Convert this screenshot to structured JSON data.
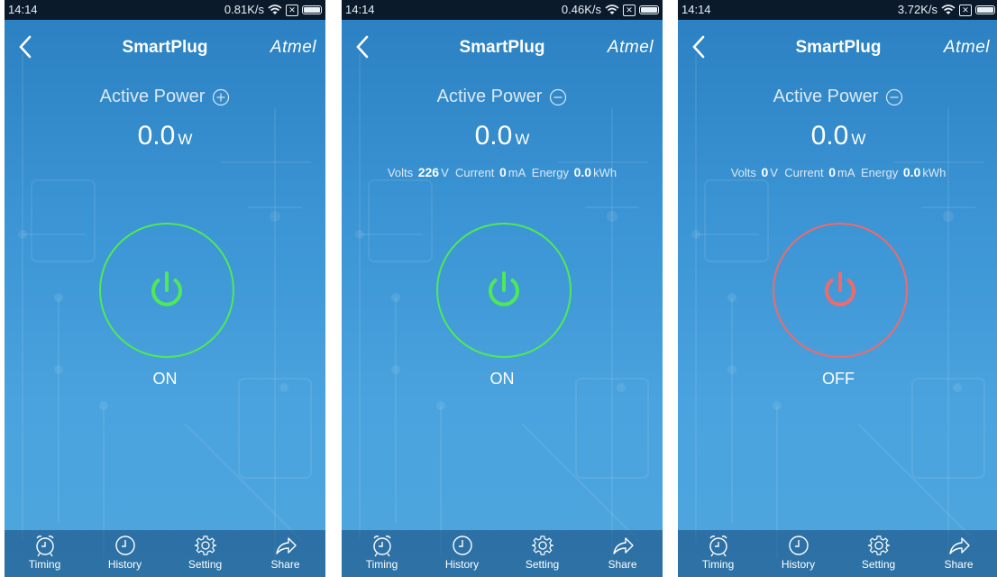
{
  "screens": [
    {
      "status": {
        "time": "14:14",
        "speed": "0.81K/s",
        "sim": "✕"
      },
      "header": {
        "title": "SmartPlug",
        "brand": "Atmel"
      },
      "power": {
        "label": "Active Power",
        "toggle_icon": "plus-circle-icon",
        "value": "0.0",
        "unit": "W"
      },
      "details": null,
      "state": {
        "label": "ON",
        "on": true,
        "color": "#4eea55"
      },
      "tabs": [
        {
          "label": "Timing"
        },
        {
          "label": "History"
        },
        {
          "label": "Setting"
        },
        {
          "label": "Share"
        }
      ]
    },
    {
      "status": {
        "time": "14:14",
        "speed": "0.46K/s",
        "sim": "✕"
      },
      "header": {
        "title": "SmartPlug",
        "brand": "Atmel"
      },
      "power": {
        "label": "Active Power",
        "toggle_icon": "minus-circle-icon",
        "value": "0.0",
        "unit": "W"
      },
      "details": {
        "volts_label": "Volts",
        "volts": "226",
        "volts_unit": "V",
        "current_label": "Current",
        "current": "0",
        "current_unit": "mA",
        "energy_label": "Energy",
        "energy": "0.0",
        "energy_unit": "kWh"
      },
      "state": {
        "label": "ON",
        "on": true,
        "color": "#4eea55"
      },
      "tabs": [
        {
          "label": "Timing"
        },
        {
          "label": "History"
        },
        {
          "label": "Setting"
        },
        {
          "label": "Share"
        }
      ]
    },
    {
      "status": {
        "time": "14:14",
        "speed": "3.72K/s",
        "sim": "✕"
      },
      "header": {
        "title": "SmartPlug",
        "brand": "Atmel"
      },
      "power": {
        "label": "Active Power",
        "toggle_icon": "minus-circle-icon",
        "value": "0.0",
        "unit": "W"
      },
      "details": {
        "volts_label": "Volts",
        "volts": "0",
        "volts_unit": "V",
        "current_label": "Current",
        "current": "0",
        "current_unit": "mA",
        "energy_label": "Energy",
        "energy": "0.0",
        "energy_unit": "kWh"
      },
      "state": {
        "label": "OFF",
        "on": false,
        "color": "#f06a6a"
      },
      "tabs": [
        {
          "label": "Timing"
        },
        {
          "label": "History"
        },
        {
          "label": "Setting"
        },
        {
          "label": "Share"
        }
      ]
    }
  ],
  "icons": {
    "back": "chevron-left-icon",
    "tabs": [
      "alarm-clock-icon",
      "clock-icon",
      "gear-icon",
      "share-arrow-icon"
    ]
  }
}
